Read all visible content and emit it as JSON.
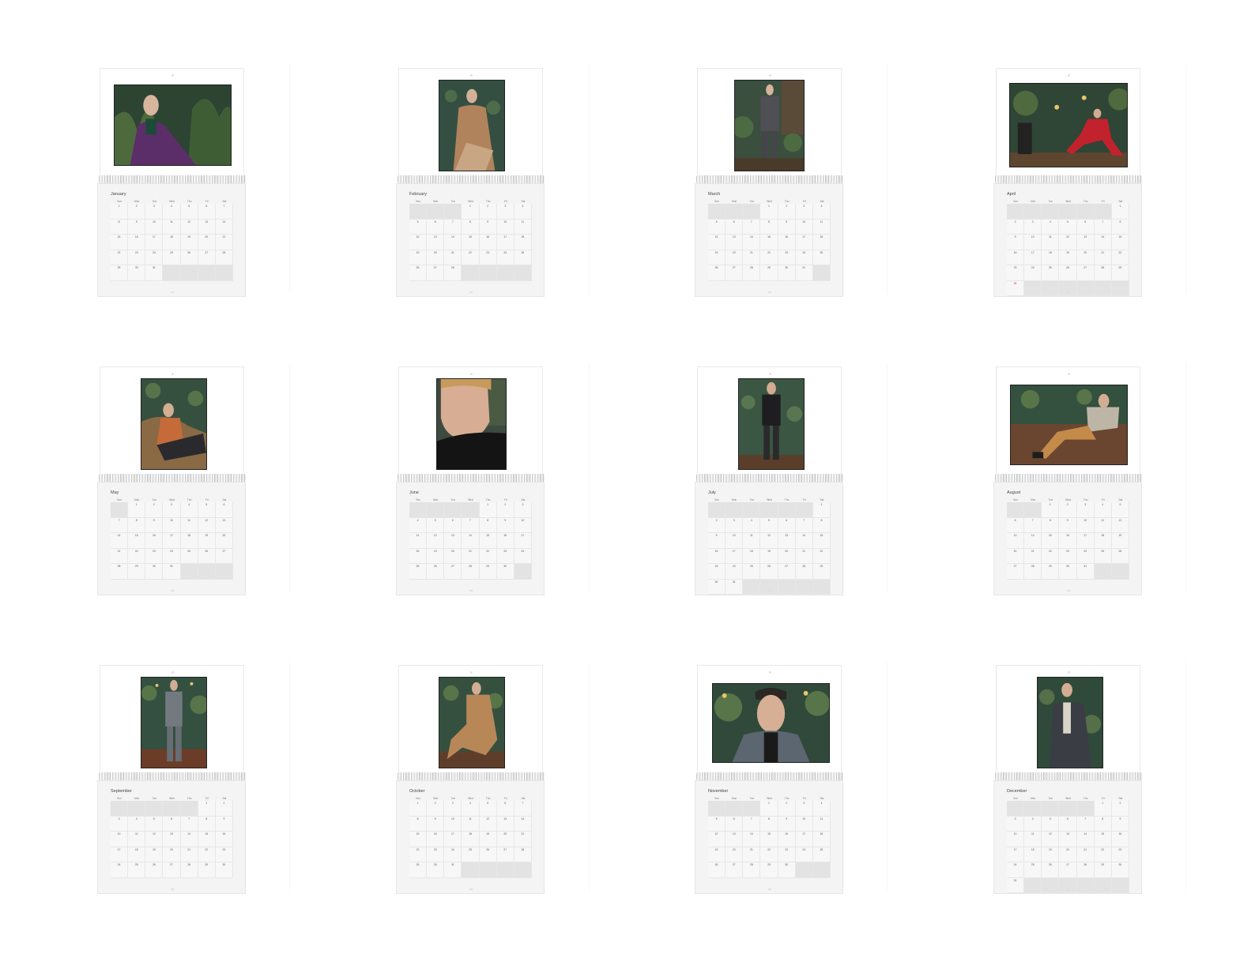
{
  "weekdays": [
    "Sun",
    "Mon",
    "Tue",
    "Wed",
    "Thu",
    "Fri",
    "Sat"
  ],
  "months": [
    {
      "name": "January",
      "start": 0,
      "days": 31,
      "rows": 5,
      "photo": "landscape-purple-coat-palms-icon"
    },
    {
      "name": "February",
      "start": 3,
      "days": 28,
      "rows": 5,
      "photo": "portrait-camel-coat-seated-icon"
    },
    {
      "name": "March",
      "start": 3,
      "days": 31,
      "rows": 5,
      "photo": "portrait-grey-suit-standing-icon"
    },
    {
      "name": "April",
      "start": 6,
      "days": 30,
      "rows": 6,
      "photo": "landscape-red-suit-seated-icon"
    },
    {
      "name": "May",
      "start": 1,
      "days": 31,
      "rows": 5,
      "photo": "portrait-reclining-shirt-icon"
    },
    {
      "name": "June",
      "start": 4,
      "days": 30,
      "rows": 5,
      "photo": "portrait-closeup-turtleneck-icon"
    },
    {
      "name": "July",
      "start": 6,
      "days": 31,
      "rows": 6,
      "photo": "portrait-leather-jacket-standing-icon"
    },
    {
      "name": "August",
      "start": 2,
      "days": 31,
      "rows": 5,
      "photo": "landscape-reclining-tan-trousers-icon"
    },
    {
      "name": "September",
      "start": 5,
      "days": 30,
      "rows": 5,
      "photo": "portrait-grey-suit-full-icon"
    },
    {
      "name": "October",
      "start": 0,
      "days": 31,
      "rows": 5,
      "photo": "portrait-camel-coat-lounging-icon"
    },
    {
      "name": "November",
      "start": 3,
      "days": 30,
      "rows": 5,
      "photo": "landscape-houndstooth-closeup-icon"
    },
    {
      "name": "December",
      "start": 5,
      "days": 31,
      "rows": 6,
      "photo": "portrait-dark-jacket-icon"
    }
  ],
  "colors": {
    "accent_red": "#c0392b",
    "leaf": "#2f4a36",
    "wall": "#3b5a48"
  }
}
